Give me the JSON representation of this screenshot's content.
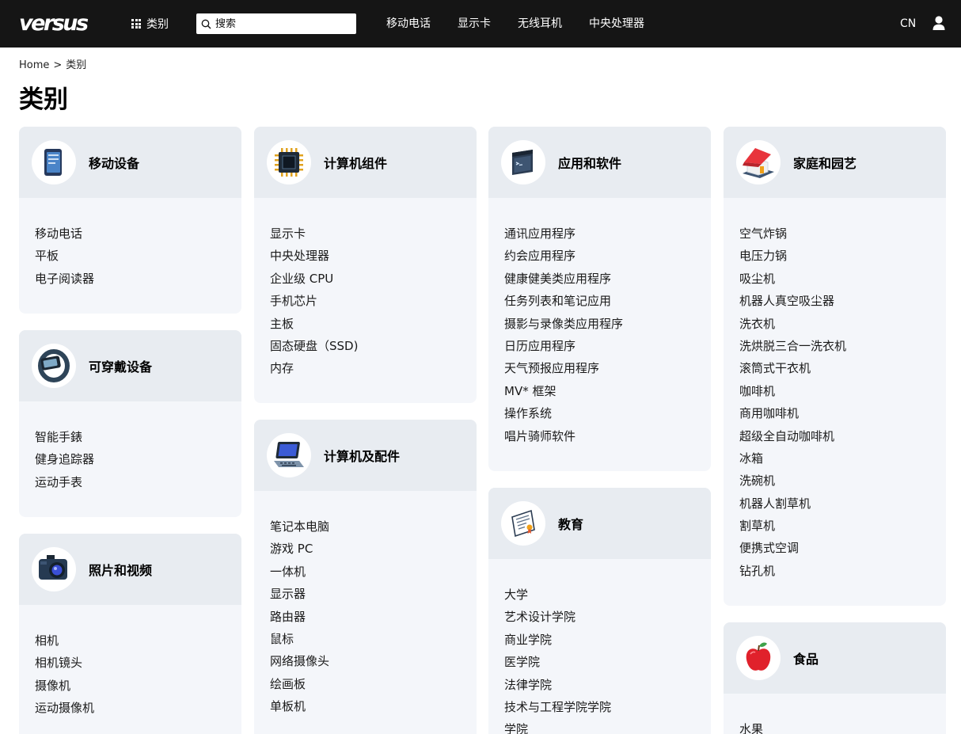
{
  "header": {
    "logo": "versus",
    "categories_label": "类别",
    "search_placeholder": "搜索",
    "nav": [
      "移动电话",
      "显示卡",
      "无线耳机",
      "中央处理器"
    ],
    "lang": "CN"
  },
  "breadcrumb": {
    "home": "Home",
    "separator": ">",
    "current": "类别"
  },
  "page_title": "类别",
  "categories": [
    {
      "title": "移动设备",
      "icon": "smartphone-icon",
      "items": [
        "移动电话",
        "平板",
        "电子阅读器"
      ]
    },
    {
      "title": "可穿戴设备",
      "icon": "smartwatch-icon",
      "items": [
        "智能手錶",
        "健身追踪器",
        "运动手表"
      ]
    },
    {
      "title": "照片和视频",
      "icon": "camera-icon",
      "items": [
        "相机",
        "相机镜头",
        "摄像机",
        "运动摄像机"
      ]
    },
    {
      "title": "计算机组件",
      "icon": "cpu-chip-icon",
      "items": [
        "显示卡",
        "中央处理器",
        "企业级 CPU",
        "手机芯片",
        "主板",
        "固态硬盘（SSD)",
        "内存"
      ]
    },
    {
      "title": "计算机及配件",
      "icon": "laptop-icon",
      "items": [
        "笔记本电脑",
        "游戏 PC",
        "一体机",
        "显示器",
        "路由器",
        "鼠标",
        "网络摄像头",
        "绘画板",
        "单板机"
      ]
    },
    {
      "title": "应用和软件",
      "icon": "app-window-icon",
      "items": [
        "通讯应用程序",
        "约会应用程序",
        "健康健美类应用程序",
        "任务列表和笔记应用",
        "摄影与录像类应用程序",
        "日历应用程序",
        "天气预报应用程序",
        "MV* 框架",
        "操作系统",
        "唱片骑师软件"
      ]
    },
    {
      "title": "教育",
      "icon": "certificate-icon",
      "items": [
        "大学",
        "艺术设计学院",
        "商业学院",
        "医学院",
        "法律学院",
        "技术与工程学院学院",
        "学院"
      ]
    },
    {
      "title": "家庭和园艺",
      "icon": "house-icon",
      "items": [
        "空气炸锅",
        "电压力锅",
        "吸尘机",
        "机器人真空吸尘器",
        "洗衣机",
        "洗烘脱三合一洗衣机",
        "滚筒式干衣机",
        "咖啡机",
        "商用咖啡机",
        "超级全自动咖啡机",
        "冰箱",
        "洗碗机",
        "机器人割草机",
        "割草机",
        "便携式空调",
        "钻孔机"
      ]
    },
    {
      "title": "食品",
      "icon": "apple-icon",
      "items": [
        "水果"
      ]
    }
  ]
}
